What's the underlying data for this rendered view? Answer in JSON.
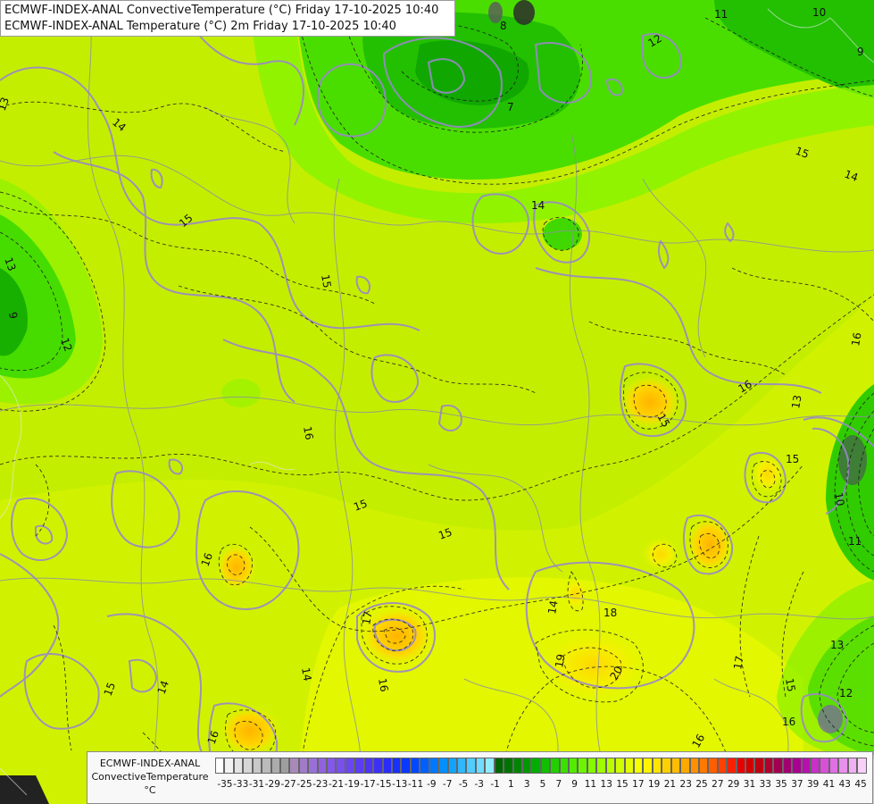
{
  "title": {
    "line1": "ECMWF-INDEX-ANAL ConvectiveTemperature (°C) Friday 17-10-2025 10:40",
    "line2": "ECMWF-INDEX-ANAL Temperature (°C) 2m Friday 17-10-2025 10:40"
  },
  "legend": {
    "line1": "ECMWF-INDEX-ANAL",
    "line2": "ConvectiveTemperature",
    "unit": "°C",
    "tick_labels": [
      "-35",
      "-33",
      "-31",
      "-29",
      "-27",
      "-25",
      "-23",
      "-21",
      "-19",
      "-17",
      "-15",
      "-13",
      "-11",
      "-9",
      "-7",
      "-5",
      "-3",
      "-1",
      "1",
      "3",
      "5",
      "7",
      "9",
      "11",
      "13",
      "15",
      "17",
      "19",
      "21",
      "23",
      "25",
      "27",
      "29",
      "31",
      "33",
      "35",
      "37",
      "39",
      "41",
      "43",
      "45"
    ],
    "colors": [
      "#ffffff",
      "#f2f2f2",
      "#e4e4e4",
      "#d6d6d6",
      "#c8c8c8",
      "#bababa",
      "#acacac",
      "#9e9e9e",
      "#a88ab8",
      "#a07cc8",
      "#9870d8",
      "#9062e0",
      "#8458ea",
      "#7850f0",
      "#6a46f2",
      "#5c3cf4",
      "#4e34f6",
      "#3c30f8",
      "#2a2cfa",
      "#1a30fc",
      "#0a38fe",
      "#0048ff",
      "#0060ff",
      "#0078ff",
      "#0090ff",
      "#10a4ff",
      "#30b8ff",
      "#50ccff",
      "#70dcff",
      "#90ecff",
      "#006400",
      "#007400",
      "#008600",
      "#009a00",
      "#00ae00",
      "#10c000",
      "#22d000",
      "#3ae000",
      "#52ec00",
      "#6cf400",
      "#86f800",
      "#a0fa00",
      "#bafc00",
      "#d0fd00",
      "#e4fe00",
      "#f6fe00",
      "#fff400",
      "#ffe400",
      "#ffd000",
      "#ffbc00",
      "#ffa800",
      "#ff9000",
      "#ff7800",
      "#ff5e00",
      "#ff4000",
      "#f82000",
      "#e80000",
      "#d40000",
      "#c00010",
      "#b00030",
      "#a40050",
      "#a00070",
      "#a80090",
      "#b810b0",
      "#c830c8",
      "#d850d8",
      "#e070e4",
      "#e890ec",
      "#f0b0f2",
      "#f8d0f8"
    ]
  },
  "map": {
    "contour_labels": [
      "13",
      "14",
      "12",
      "15",
      "11",
      "10",
      "9",
      "8",
      "7",
      "16",
      "17",
      "18",
      "19",
      "20"
    ]
  }
}
